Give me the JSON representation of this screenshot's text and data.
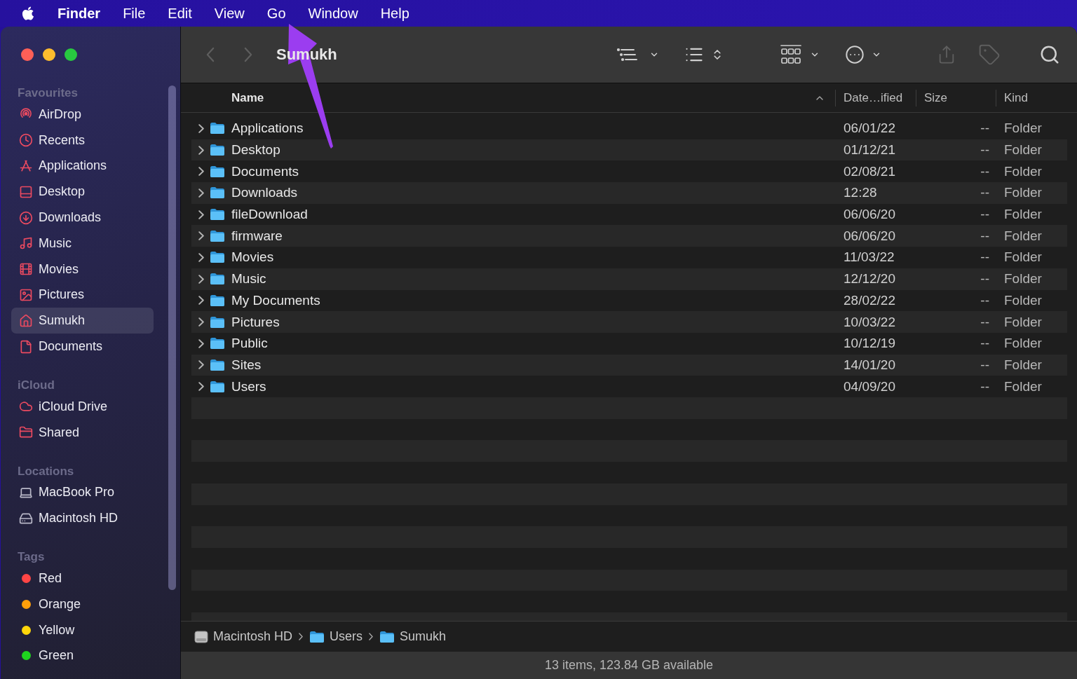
{
  "menu_bar": {
    "app_name": "Finder",
    "menus": [
      "File",
      "Edit",
      "View",
      "Go",
      "Window",
      "Help"
    ]
  },
  "window": {
    "title": "Sumukh"
  },
  "sidebar": {
    "sections": [
      {
        "heading": "Favourites",
        "items": [
          {
            "label": "AirDrop",
            "kind": "airdrop",
            "selected": false
          },
          {
            "label": "Recents",
            "kind": "recents",
            "selected": false
          },
          {
            "label": "Applications",
            "kind": "applications",
            "selected": false
          },
          {
            "label": "Desktop",
            "kind": "desktop",
            "selected": false
          },
          {
            "label": "Downloads",
            "kind": "downloads",
            "selected": false
          },
          {
            "label": "Music",
            "kind": "music",
            "selected": false
          },
          {
            "label": "Movies",
            "kind": "movies",
            "selected": false
          },
          {
            "label": "Pictures",
            "kind": "pictures",
            "selected": false
          },
          {
            "label": "Sumukh",
            "kind": "home",
            "selected": true
          },
          {
            "label": "Documents",
            "kind": "documents",
            "selected": false
          }
        ]
      },
      {
        "heading": "iCloud",
        "items": [
          {
            "label": "iCloud Drive",
            "kind": "icloud",
            "selected": false
          },
          {
            "label": "Shared",
            "kind": "shared",
            "selected": false
          }
        ]
      },
      {
        "heading": "Locations",
        "items": [
          {
            "label": "MacBook Pro",
            "kind": "laptop",
            "selected": false
          },
          {
            "label": "Macintosh HD",
            "kind": "drive",
            "selected": false
          }
        ]
      },
      {
        "heading": "Tags",
        "items": [
          {
            "label": "Red",
            "kind": "tag",
            "color": "#ff4545",
            "selected": false
          },
          {
            "label": "Orange",
            "kind": "tag",
            "color": "#ff9f0a",
            "selected": false
          },
          {
            "label": "Yellow",
            "kind": "tag",
            "color": "#ffd60a",
            "selected": false
          },
          {
            "label": "Green",
            "kind": "tag",
            "color": "#1ed31e",
            "selected": false
          }
        ]
      }
    ]
  },
  "navigation": [
    {
      "kind": "back",
      "disabled": true
    },
    {
      "kind": "forward",
      "disabled": true
    }
  ],
  "toolbar": [
    {
      "kind": "view-options",
      "disabled": false
    },
    {
      "kind": "group",
      "disabled": false
    },
    {
      "kind": "gallery",
      "disabled": false
    },
    {
      "kind": "actions",
      "disabled": false
    },
    {
      "kind": "share",
      "disabled": true
    },
    {
      "kind": "tags",
      "disabled": true
    },
    {
      "kind": "search",
      "disabled": false
    }
  ],
  "table": {
    "columns": [
      {
        "label": "Name",
        "sorted": true
      },
      {
        "label": "Date…ified",
        "sorted": false
      },
      {
        "label": "Size",
        "sorted": false
      },
      {
        "label": "Kind",
        "sorted": false
      }
    ],
    "rows": [
      {
        "name": "Applications",
        "date_modified": "06/01/22",
        "size": "--",
        "file_kind": "Folder",
        "expanded": false
      },
      {
        "name": "Desktop",
        "date_modified": "01/12/21",
        "size": "--",
        "file_kind": "Folder",
        "expanded": false
      },
      {
        "name": "Documents",
        "date_modified": "02/08/21",
        "size": "--",
        "file_kind": "Folder",
        "expanded": false
      },
      {
        "name": "Downloads",
        "date_modified": "12:28",
        "size": "--",
        "file_kind": "Folder",
        "expanded": false
      },
      {
        "name": "fileDownload",
        "date_modified": "06/06/20",
        "size": "--",
        "file_kind": "Folder",
        "expanded": false
      },
      {
        "name": "firmware",
        "date_modified": "06/06/20",
        "size": "--",
        "file_kind": "Folder",
        "expanded": false
      },
      {
        "name": "Movies",
        "date_modified": "11/03/22",
        "size": "--",
        "file_kind": "Folder",
        "expanded": false
      },
      {
        "name": "Music",
        "date_modified": "12/12/20",
        "size": "--",
        "file_kind": "Folder",
        "expanded": false
      },
      {
        "name": "My Documents",
        "date_modified": "28/02/22",
        "size": "--",
        "file_kind": "Folder",
        "expanded": false
      },
      {
        "name": "Pictures",
        "date_modified": "10/03/22",
        "size": "--",
        "file_kind": "Folder",
        "expanded": false
      },
      {
        "name": "Public",
        "date_modified": "10/12/19",
        "size": "--",
        "file_kind": "Folder",
        "expanded": false
      },
      {
        "name": "Sites",
        "date_modified": "14/01/20",
        "size": "--",
        "file_kind": "Folder",
        "expanded": false
      },
      {
        "name": "Users",
        "date_modified": "04/09/20",
        "size": "--",
        "file_kind": "Folder",
        "expanded": false
      }
    ]
  },
  "path_bar": [
    {
      "label": "Macintosh HD",
      "kind": "disk"
    },
    {
      "label": "Users",
      "kind": "folder"
    },
    {
      "label": "Sumukh",
      "kind": "folder"
    }
  ],
  "status_bar": {
    "text": "13 items, 123.84 GB available"
  }
}
